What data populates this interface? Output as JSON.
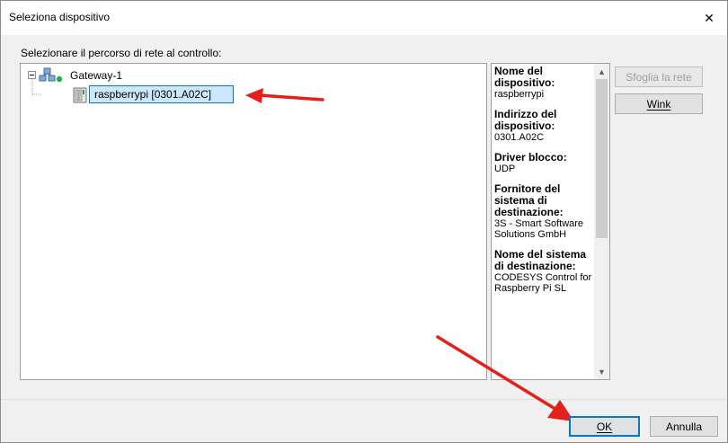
{
  "window": {
    "title": "Seleziona dispositivo",
    "close_glyph": "✕"
  },
  "instruction": "Selezionare il percorso di rete al controllo:",
  "tree": {
    "gateway": {
      "label": "Gateway-1",
      "icon": "network-gateway-icon",
      "status_color": "#22b14c"
    },
    "device": {
      "label": "raspberrypi [0301.A02C]",
      "icon": "plc-device-icon",
      "selected": true
    }
  },
  "info": [
    {
      "head": "Nome del dispositivo:",
      "value": "raspberrypi"
    },
    {
      "head": "Indirizzo del dispositivo:",
      "value": "0301.A02C"
    },
    {
      "head": "Driver blocco:",
      "value": "UDP"
    },
    {
      "head": "Fornitore del sistema di destinazione:",
      "value": "3S - Smart Software Solutions GmbH"
    },
    {
      "head": "Nome del sistema di destinazione:",
      "value": "CODESYS Control for Raspberry Pi SL"
    }
  ],
  "buttons": {
    "browse": "Sfoglia la rete",
    "wink": "Wink",
    "ok": "OK",
    "cancel": "Annulla"
  },
  "colors": {
    "annotation_arrow": "#e3201b",
    "selection_border": "#0078d7",
    "selection_fill": "#cce8ff"
  }
}
